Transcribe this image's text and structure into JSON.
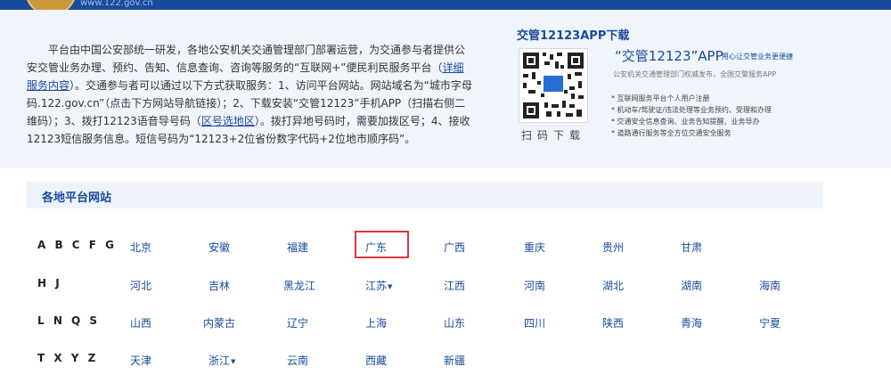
{
  "header": {
    "url": "www.122.gov.cn"
  },
  "intro": {
    "part1": "平台由中国公安部统一研发，各地公安机关交通管理部门部署运营，为交通参与者提供公安交管业务办理、预约、告知、信息查询、咨询等服务的“互联网+”便民利民服务平台（",
    "link1": "详细服务内容",
    "part2": "）。交通参与者可以通过以下方式获取服务：1、访问平台网站。网站域名为“城市字母码.122.gov.cn”（点击下方网站导航链接）；2、下载安装“交管12123”手机APP（扫描右侧二维码）；3、拨打12123语音导号码（",
    "link2": "区号选地区",
    "part3": "）。拨打异地号码时，需要加拨区号；4、接收12123短信服务信息。短信号码为“12123+2位省份数字代码+2位地市顺序码”。"
  },
  "app": {
    "section_title": "交管12123APP下载",
    "qr_label": "扫码下载",
    "qr_badge": "交管",
    "name": "“交管12123”APP",
    "slogan": "用心让交管业务更便捷",
    "subtitle": "公安机关交通管理部门权威发布，全国交警服务APP",
    "features": [
      "* 互联网服务平台个人用户注册",
      "* 机动车/驾驶证/违法处理等业务预约、受理和办理",
      "* 交通安全信息查询、业务告知提醒、业务导办",
      "* 道路通行服务等全方位交通安全服务"
    ]
  },
  "platforms": {
    "title": "各地平台网站",
    "rows": [
      {
        "key": "A B C F G",
        "items": [
          "北京",
          "安徽",
          "福建",
          "广东",
          "广西",
          "重庆",
          "贵州",
          "甘肃"
        ]
      },
      {
        "key": "H J",
        "items": [
          "河北",
          "吉林",
          "黑龙江",
          "江苏",
          "江西",
          "河南",
          "湖北",
          "湖南",
          "海南"
        ]
      },
      {
        "key": "L N Q S",
        "items": [
          "山西",
          "内蒙古",
          "辽宁",
          "上海",
          "山东",
          "四川",
          "陕西",
          "青海",
          "宁夏"
        ]
      },
      {
        "key": "T X Y Z",
        "items": [
          "天津",
          "浙江",
          "云南",
          "西藏",
          "新疆"
        ]
      }
    ],
    "dropdown_caret": "▼"
  },
  "colors": {
    "brand": "#1a4a9c",
    "highlight": "#d93a3a",
    "panel": "#f0f4fb"
  }
}
